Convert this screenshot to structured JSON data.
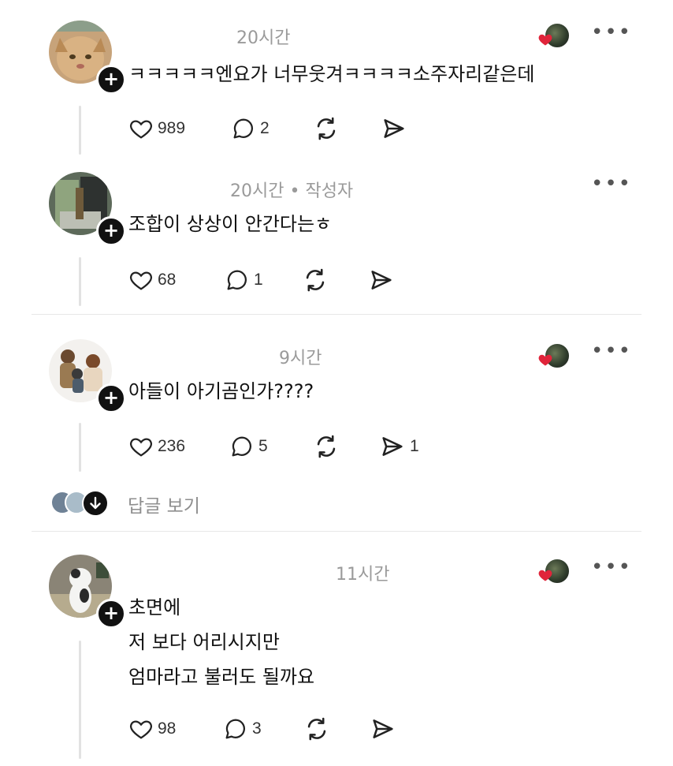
{
  "posts": [
    {
      "time": "20시간",
      "author_label": "",
      "lines": [
        "ㅋㅋㅋㅋㅋ엔요가 너무웃겨ㅋㅋㅋㅋ소주자리같은데"
      ],
      "likes": "989",
      "replies": "2",
      "shares": "",
      "liked_by_author": true
    },
    {
      "time": "20시간",
      "author_label": "• 작성자",
      "lines": [
        "조합이 상상이 안간다는ㅎ"
      ],
      "likes": "68",
      "replies": "1",
      "shares": "",
      "liked_by_author": false
    },
    {
      "time": "9시간",
      "author_label": "",
      "lines": [
        "아들이 아기곰인가????"
      ],
      "likes": "236",
      "replies": "5",
      "shares": "1",
      "liked_by_author": true
    },
    {
      "time": "11시간",
      "author_label": "",
      "lines": [
        "초면에",
        "저 보다 어리시지만",
        "엄마라고 불러도 될까요"
      ],
      "likes": "98",
      "replies": "3",
      "shares": "",
      "liked_by_author": true
    }
  ],
  "view_replies_label": "답글 보기",
  "icons": {
    "like": "heart-outline-icon",
    "reply": "speech-bubble-icon",
    "repost": "repost-icon",
    "share": "send-icon",
    "more": "more-dots-icon",
    "follow": "plus-icon"
  },
  "colors": {
    "liked_heart": "#e0243a",
    "muted_text": "#9a9a9a"
  }
}
